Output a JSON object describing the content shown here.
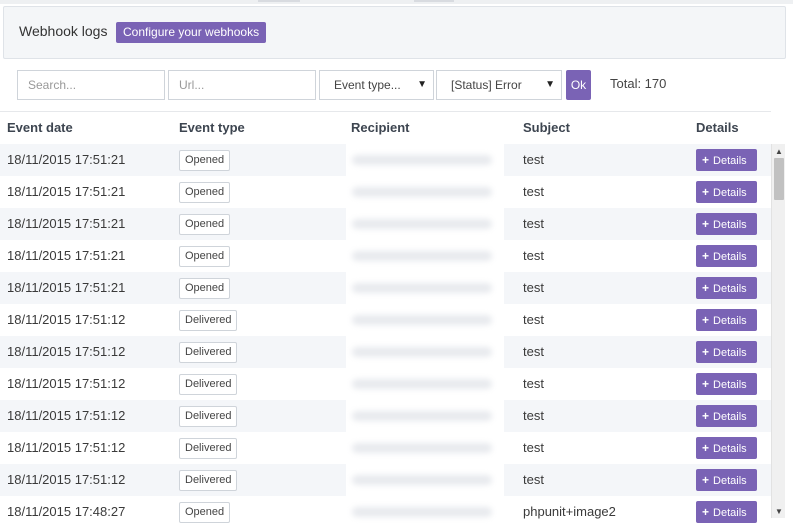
{
  "header": {
    "title": "Webhook logs",
    "configure_label": "Configure your webhooks"
  },
  "filters": {
    "search_placeholder": "Search...",
    "url_placeholder": "Url...",
    "event_type_value": "Event type...",
    "status_value": "[Status] Error",
    "ok_label": "Ok",
    "total_text": "Total: 170"
  },
  "table": {
    "columns": [
      "Event date",
      "Event type",
      "Recipient",
      "Subject",
      "Details"
    ],
    "details_label": "Details",
    "rows": [
      {
        "date": "18/11/2015 17:51:21",
        "event": "Opened",
        "subject": "test"
      },
      {
        "date": "18/11/2015 17:51:21",
        "event": "Opened",
        "subject": "test"
      },
      {
        "date": "18/11/2015 17:51:21",
        "event": "Opened",
        "subject": "test"
      },
      {
        "date": "18/11/2015 17:51:21",
        "event": "Opened",
        "subject": "test"
      },
      {
        "date": "18/11/2015 17:51:21",
        "event": "Opened",
        "subject": "test"
      },
      {
        "date": "18/11/2015 17:51:12",
        "event": "Delivered",
        "subject": "test"
      },
      {
        "date": "18/11/2015 17:51:12",
        "event": "Delivered",
        "subject": "test"
      },
      {
        "date": "18/11/2015 17:51:12",
        "event": "Delivered",
        "subject": "test"
      },
      {
        "date": "18/11/2015 17:51:12",
        "event": "Delivered",
        "subject": "test"
      },
      {
        "date": "18/11/2015 17:51:12",
        "event": "Delivered",
        "subject": "test"
      },
      {
        "date": "18/11/2015 17:51:12",
        "event": "Delivered",
        "subject": "test"
      },
      {
        "date": "18/11/2015 17:48:27",
        "event": "Opened",
        "subject": "phpunit+image2"
      }
    ]
  },
  "icons": {
    "details_icon": "plus-icon",
    "dropdown_icon": "caret-down-icon"
  },
  "colors": {
    "accent": "#7a63b5"
  }
}
